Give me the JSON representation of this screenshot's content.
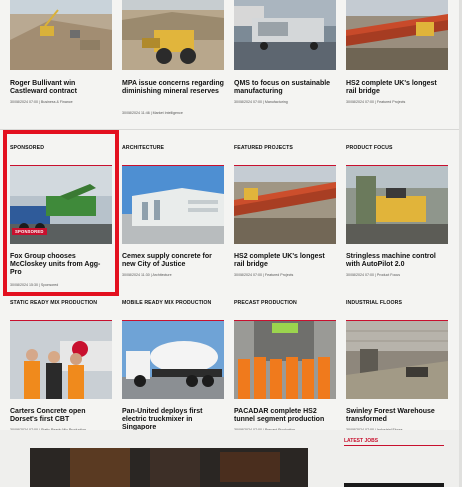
{
  "colors": {
    "accent": "#c8102e",
    "sponsor_frame": "#e3101f",
    "background": "#f4f4f2"
  },
  "row1": [
    {
      "title": "Roger Bullivant win Castleward contract",
      "date": "30/08/2024 07:00",
      "category": "Business & Finance",
      "image": "construction-site"
    },
    {
      "title": "MPA issue concerns regarding diminishing mineral reserves",
      "date": "30/08/2024 11:46",
      "category": "Market Intelligence",
      "image": "quarry-loader"
    },
    {
      "title": "QMS to focus on sustainable manufacturing",
      "date": "30/08/2024 07:00",
      "category": "Manufacturing",
      "image": "trailer-machine"
    },
    {
      "title": "HS2 complete UK's longest rail bridge",
      "date": "30/08/2024 07:00",
      "category": "Featured Projects",
      "image": "rail-bridge"
    }
  ],
  "row2": [
    {
      "section": "SPONSORED",
      "title": "Fox Group chooses McCloskey units from Agg-Pro",
      "date": "30/08/2024 15:30",
      "category": "Sponsored",
      "badge": "SPONSORED",
      "image": "tracked-machine"
    },
    {
      "section": "ARCHITECTURE",
      "title": "Cemex supply concrete for new City of Justice",
      "date": "30/08/2024 11:30",
      "category": "Architecture",
      "image": "white-building"
    },
    {
      "section": "FEATURED PROJECTS",
      "title": "HS2 complete UK's longest rail bridge",
      "date": "30/08/2024 07:00",
      "category": "Featured Projects",
      "image": "rail-bridge-2"
    },
    {
      "section": "PRODUCT FOCUS",
      "title": "Stringless machine control with AutoPilot 2.0",
      "date": "30/08/2024 07:00",
      "category": "Product Focus",
      "image": "paver-machine"
    }
  ],
  "row3": [
    {
      "section": "STATIC READY MIX PRODUCTION",
      "title": "Carters Concrete open Dorset's first CBT",
      "date": "30/08/2024 07:00",
      "category": "Static Ready Mix Production",
      "image": "workers-truck"
    },
    {
      "section": "MOBILE READY MIX PRODUCTION",
      "title": "Pan-United deploys first electric truckmixer in Singapore",
      "date": "30/08/2024 08:00",
      "category": "Mobile Ready Mix Production",
      "image": "truck-mixer"
    },
    {
      "section": "PRECAST PRODUCTION",
      "title": "PACADAR complete HS2 tunnel segment production",
      "date": "30/08/2024 07:00",
      "category": "Precast Production",
      "image": "workers-group"
    },
    {
      "section": "INDUSTRIAL FLOORS",
      "title": "Swinley Forest Warehouse transformed",
      "date": "30/08/2024 07:00",
      "category": "Industrial Floors",
      "image": "warehouse-floor"
    }
  ],
  "sidebar": {
    "latest_jobs": "LATEST JOBS"
  }
}
